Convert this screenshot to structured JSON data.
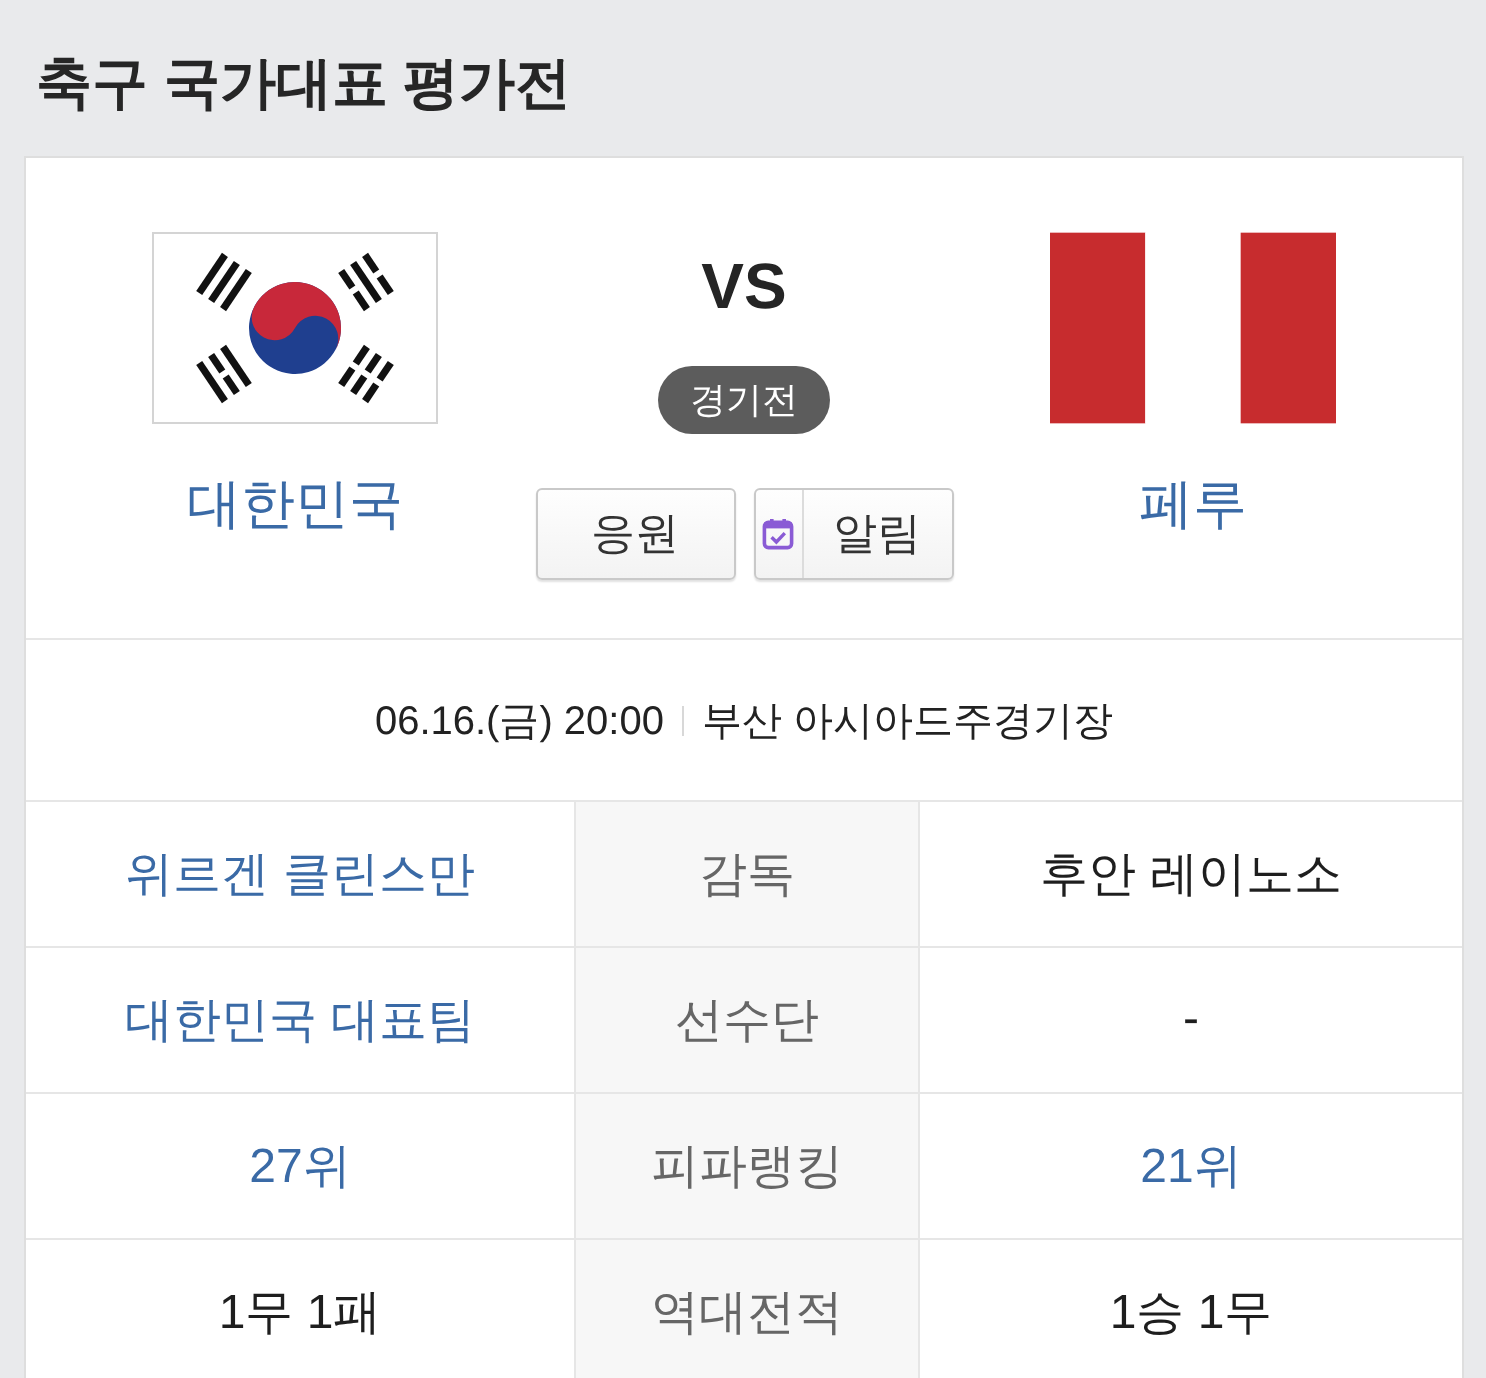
{
  "title": "축구 국가대표 평가전",
  "match": {
    "teams": [
      {
        "name": "대한민국"
      },
      {
        "name": "페루"
      }
    ],
    "vs": "VS",
    "status": "경기전",
    "buttons": [
      {
        "label": "응원",
        "kind": "text"
      },
      {
        "label": "알림",
        "kind": "icon"
      }
    ]
  },
  "schedule": {
    "datetime": "06.16.(금) 20:00",
    "venue": "부산 아시아드주경기장"
  },
  "rows": [
    {
      "home": {
        "text": "위르겐 클린스만",
        "link": true
      },
      "label": "감독",
      "away": {
        "text": "후안 레이노소",
        "link": false
      }
    },
    {
      "home": {
        "text": "대한민국 대표팀",
        "link": true
      },
      "label": "선수단",
      "away": {
        "text": "-",
        "link": false
      }
    },
    {
      "home": {
        "text": "27위",
        "link": true
      },
      "label": "피파랭킹",
      "away": {
        "text": "21위",
        "link": true
      }
    },
    {
      "home": {
        "text": "1무 1패",
        "link": false
      },
      "label": "역대전적",
      "away": {
        "text": "1승 1무",
        "link": false
      }
    }
  ]
}
